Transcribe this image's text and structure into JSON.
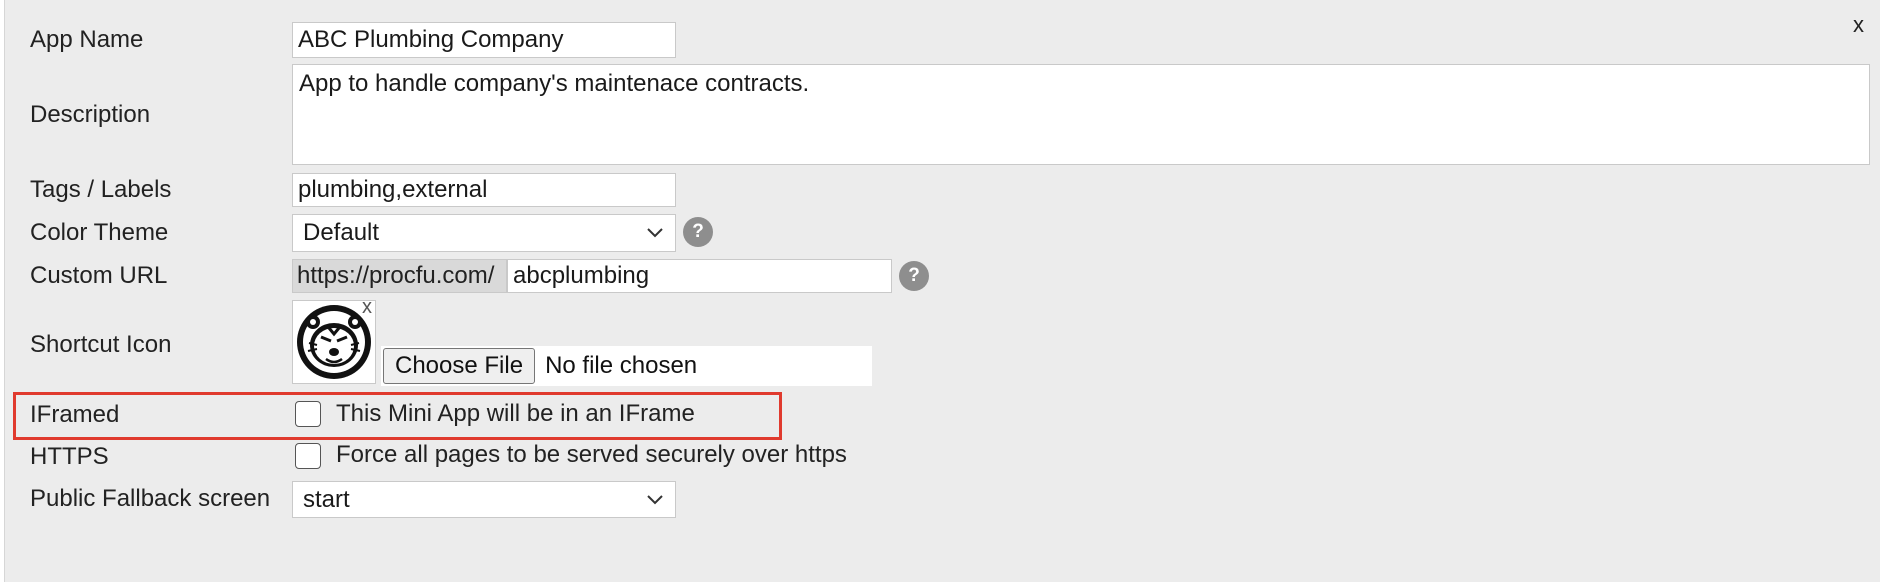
{
  "close_label": "x",
  "form": {
    "app_name": {
      "label": "App Name",
      "value": "ABC Plumbing Company"
    },
    "description": {
      "label": "Description",
      "value": "App to handle company's maintenace contracts."
    },
    "tags": {
      "label": "Tags / Labels",
      "value": "plumbing,external"
    },
    "color_theme": {
      "label": "Color Theme",
      "value": "Default",
      "help": "?"
    },
    "custom_url": {
      "label": "Custom URL",
      "prefix": "https://procfu.com/",
      "value": "abcplumbing",
      "help": "?"
    },
    "shortcut_icon": {
      "label": "Shortcut Icon",
      "remove": "x",
      "choose_file": "Choose File",
      "file_status": "No file chosen"
    },
    "iframed": {
      "label": "IFramed",
      "text": "This Mini App will be in an IFrame",
      "checked": false
    },
    "https": {
      "label": "HTTPS",
      "text": "Force all pages to be served securely over https",
      "checked": false
    },
    "fallback": {
      "label": "Public Fallback screen",
      "value": "start"
    }
  },
  "colors": {
    "highlight": "#e03a2e",
    "panel": "#ececec",
    "help_badge": "#8e8e8e"
  }
}
